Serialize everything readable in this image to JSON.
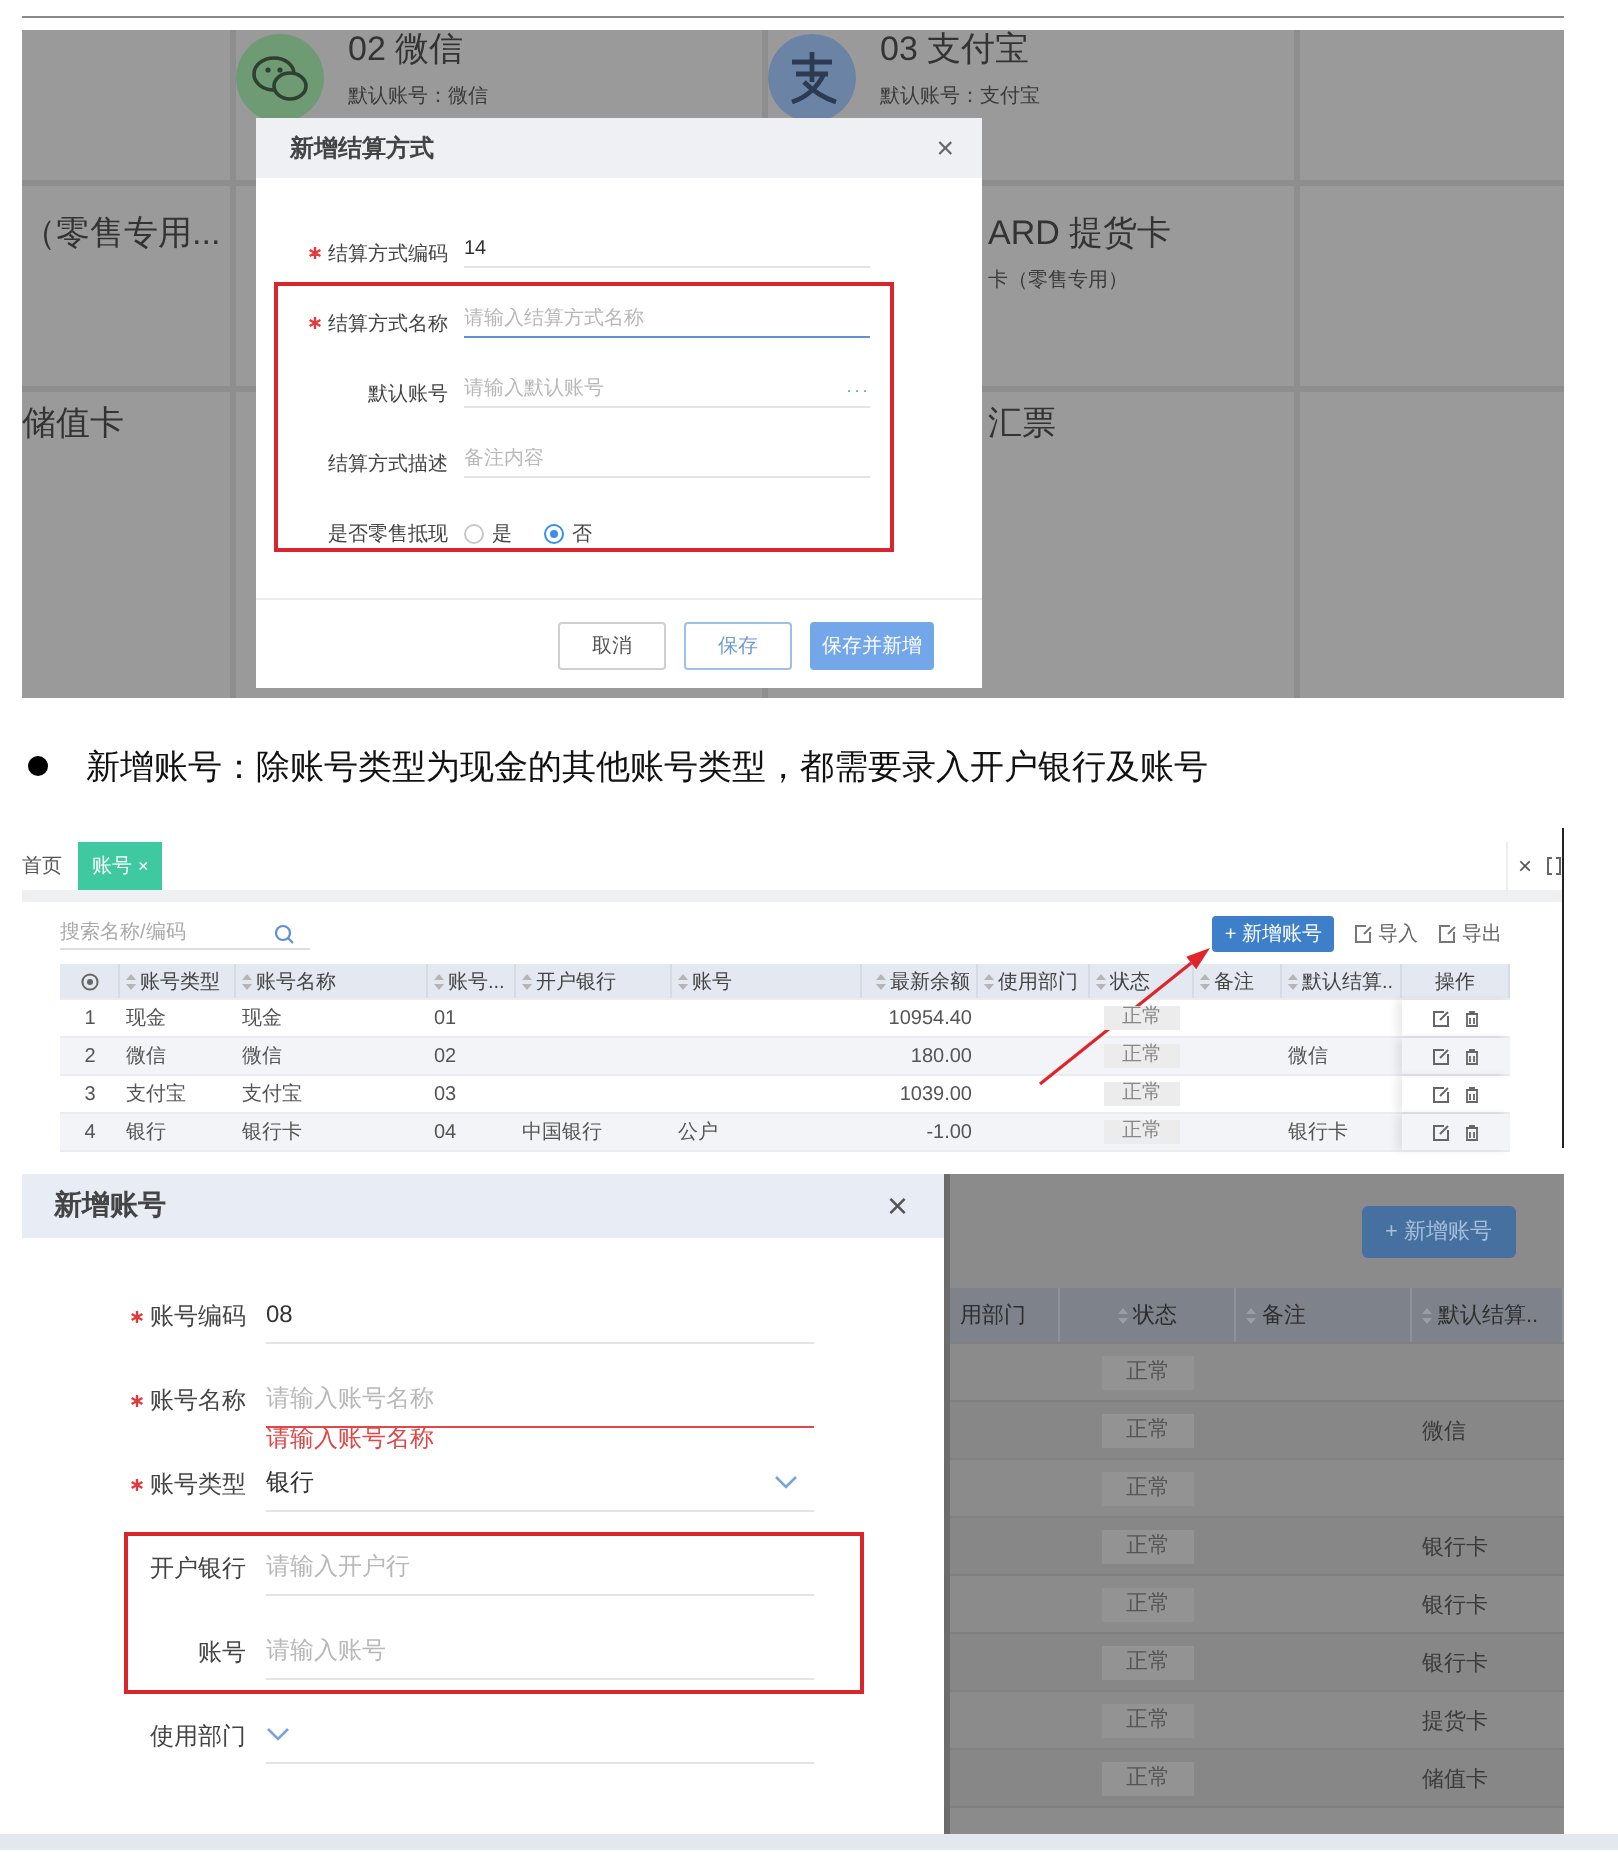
{
  "settlement_screenshot": {
    "background_cards": [
      {
        "title": "02 微信",
        "subtitle": "默认账号：微信",
        "kind": "wechat"
      },
      {
        "title": "03 支付宝",
        "subtitle": "默认账号：支付宝",
        "kind": "alipay"
      },
      {
        "title": "（零售专用..."
      },
      {
        "title": "ARD 提货卡",
        "subtitle": "卡（零售专用）"
      },
      {
        "title": "储值卡"
      },
      {
        "title": "汇票"
      }
    ],
    "dialog": {
      "title": "新增结算方式",
      "close": "×",
      "fields": [
        {
          "kind": "text",
          "label": "结算方式编码",
          "required": true,
          "value": "14"
        },
        {
          "kind": "text",
          "label": "结算方式名称",
          "required": true,
          "placeholder": "请输入结算方式名称",
          "focused": true
        },
        {
          "kind": "picker",
          "label": "默认账号",
          "required": false,
          "placeholder": "请输入默认账号",
          "button": "···"
        },
        {
          "kind": "text",
          "label": "结算方式描述",
          "required": false,
          "placeholder": "备注内容"
        },
        {
          "kind": "radio",
          "label": "是否零售抵现",
          "required": false,
          "options": [
            {
              "label": "是",
              "selected": false
            },
            {
              "label": "否",
              "selected": true
            }
          ]
        }
      ],
      "buttons": [
        {
          "label": "取消",
          "kind": "default"
        },
        {
          "label": "保存",
          "kind": "outline"
        },
        {
          "label": "保存并新增",
          "kind": "primary"
        }
      ]
    }
  },
  "bullet": {
    "text": "新增账号：除账号类型为现金的其他账号类型，都需要录入开户银行及账号"
  },
  "accounts_screenshot": {
    "tabs": [
      {
        "label": "首页",
        "selected": false
      },
      {
        "label": "账号",
        "selected": true,
        "close": "×"
      }
    ],
    "window_close": "×",
    "search": {
      "placeholder": "搜索名称/编码"
    },
    "toolbar": [
      {
        "label": "+ 新增账号",
        "kind": "primary"
      },
      {
        "label": "导入",
        "kind": "import"
      },
      {
        "label": "导出",
        "kind": "export"
      }
    ],
    "table": {
      "columns": [
        "账号类型",
        "账号名称",
        "账号...",
        "开户银行",
        "账号",
        "最新余额",
        "使用部门",
        "状态",
        "备注",
        "默认结算..",
        "操作"
      ],
      "rows": [
        {
          "no": "1",
          "type": "现金",
          "name": "现金",
          "code": "01",
          "balance": "10954.40",
          "status": "正常"
        },
        {
          "no": "2",
          "type": "微信",
          "name": "微信",
          "code": "02",
          "balance": "180.00",
          "status": "正常",
          "default": "微信"
        },
        {
          "no": "3",
          "type": "支付宝",
          "name": "支付宝",
          "code": "03",
          "balance": "1039.00",
          "status": "正常"
        },
        {
          "no": "4",
          "type": "银行",
          "name": "银行卡",
          "code": "04",
          "bank": "中国银行",
          "account": "公户",
          "balance": "-1.00",
          "status": "正常",
          "default": "银行卡"
        }
      ]
    }
  },
  "account_dialog_screenshot": {
    "dialog": {
      "title": "新增账号",
      "close": "×",
      "fields": [
        {
          "kind": "text",
          "label": "账号编码",
          "required": true,
          "value": "08"
        },
        {
          "kind": "text",
          "label": "账号名称",
          "required": true,
          "placeholder": "请输入账号名称",
          "error": "请输入账号名称"
        },
        {
          "kind": "select",
          "label": "账号类型",
          "required": true,
          "value": "银行"
        },
        {
          "kind": "text",
          "label": "开户银行",
          "required": false,
          "placeholder": "请输入开户行"
        },
        {
          "kind": "text",
          "label": "账号",
          "required": false,
          "placeholder": "请输入账号"
        },
        {
          "kind": "select",
          "label": "使用部门",
          "required": false
        }
      ]
    },
    "background": {
      "button": "+ 新增账号",
      "columns": [
        "用部门",
        "状态",
        "备注",
        "默认结算.."
      ],
      "rows": [
        {
          "status": "正常"
        },
        {
          "status": "正常",
          "default": "微信"
        },
        {
          "status": "正常"
        },
        {
          "status": "正常",
          "default": "银行卡"
        },
        {
          "status": "正常",
          "default": "银行卡"
        },
        {
          "status": "正常",
          "default": "银行卡"
        },
        {
          "status": "正常",
          "default": "提货卡"
        },
        {
          "status": "正常",
          "default": "储值卡"
        }
      ]
    }
  }
}
